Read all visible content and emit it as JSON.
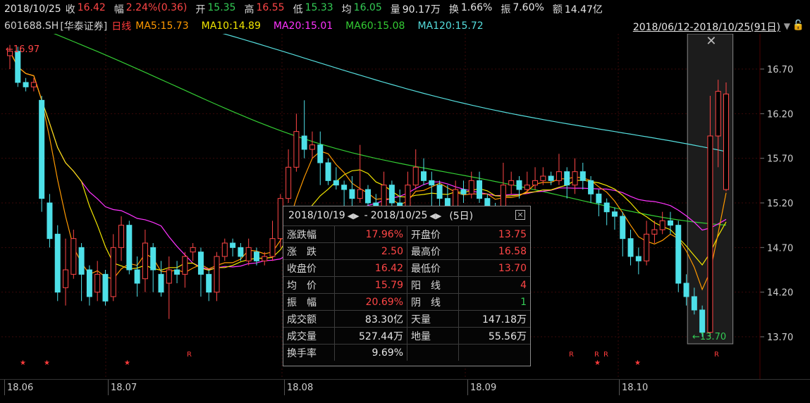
{
  "quote": {
    "date": "2018/10/25",
    "close_label": "收",
    "close": "16.42",
    "change_label": "幅",
    "change": "2.24%(0.36)",
    "open_label": "开",
    "open": "15.35",
    "high_label": "高",
    "high": "16.55",
    "low_label": "低",
    "low": "15.33",
    "avg_label": "均",
    "avg": "16.05",
    "volume_label": "量",
    "volume": "90.17万",
    "turnover_label": "换",
    "turnover": "1.66%",
    "amplitude_label": "振",
    "amplitude": "7.60%",
    "amount_label": "额",
    "amount": "14.47亿"
  },
  "legend": {
    "code": "601688.SH",
    "name": "[华泰证券]",
    "timeframe": "日线",
    "ma5": "MA5:15.73",
    "ma10": "MA10:14.89",
    "ma20": "MA20:15.01",
    "ma60": "MA60:15.08",
    "ma120": "MA120:15.72",
    "range": "2018/06/12-2018/10/25(91日)"
  },
  "colors": {
    "up": "#ff4646",
    "down": "#33cc55",
    "ma5": "#ff9900",
    "ma10": "#f2e600",
    "ma20": "#ff33ff",
    "ma60": "#33cc33",
    "ma120": "#55dddd",
    "candle_down": "#4ee0e8"
  },
  "axis": {
    "y_ticks": [
      "16.70",
      "16.20",
      "15.70",
      "15.20",
      "14.70",
      "14.20",
      "13.70"
    ],
    "x_labels": [
      "18.06",
      "18.07",
      "18.08",
      "18.09",
      "18.10"
    ],
    "max_marker": "16.97",
    "min_marker": "13.70"
  },
  "markers": [
    "★",
    "★",
    "★",
    "R",
    "R",
    "R",
    "R",
    "★",
    "★",
    "R"
  ],
  "popup": {
    "start": "2018/10/19",
    "end": "2018/10/25",
    "days": "(5日)",
    "rows": [
      {
        "k1": "涨跌幅",
        "v1": "17.96%",
        "k2": "开盘价",
        "v2": "13.75"
      },
      {
        "k1": "涨　跌",
        "v1": "2.50",
        "k2": "最高价",
        "v2": "16.58"
      },
      {
        "k1": "收盘价",
        "v1": "16.42",
        "k2": "最低价",
        "v2": "13.70"
      },
      {
        "k1": "均　价",
        "v1": "15.79",
        "k2": "阳　线",
        "v2": "4"
      },
      {
        "k1": "振　幅",
        "v1": "20.69%",
        "k2": "阴　线",
        "v2": "1"
      },
      {
        "k1": "成交额",
        "v1": "83.30亿",
        "k2": "天量",
        "v2": "147.18万"
      },
      {
        "k1": "成交量",
        "v1": "527.44万",
        "k2": "地量",
        "v2": "55.56万"
      },
      {
        "k1": "换手率",
        "v1": "9.69%",
        "k2": "",
        "v2": ""
      }
    ]
  },
  "chart_data": {
    "type": "candlestick",
    "ylim": [
      13.6,
      17.1
    ],
    "y_ticks": [
      16.7,
      16.2,
      15.7,
      15.2,
      14.7,
      14.2,
      13.7
    ],
    "candles": [
      [
        16.85,
        16.9,
        16.97,
        16.7
      ],
      [
        16.9,
        16.55,
        16.95,
        16.5
      ],
      [
        16.55,
        16.5,
        16.6,
        16.45
      ],
      [
        16.5,
        16.55,
        16.6,
        16.45
      ],
      [
        16.35,
        15.25,
        16.4,
        15.1
      ],
      [
        15.2,
        14.8,
        15.3,
        14.7
      ],
      [
        14.85,
        14.2,
        14.95,
        14.1
      ],
      [
        14.25,
        14.45,
        14.8,
        14.05
      ],
      [
        14.4,
        14.8,
        14.9,
        14.35
      ],
      [
        14.7,
        14.4,
        14.75,
        14.1
      ],
      [
        14.45,
        14.15,
        14.5,
        14.05
      ],
      [
        14.2,
        14.4,
        14.55,
        14.1
      ],
      [
        14.4,
        14.1,
        14.45,
        14.05
      ],
      [
        14.15,
        14.7,
        14.85,
        14.1
      ],
      [
        14.7,
        14.95,
        15.05,
        14.55
      ],
      [
        14.95,
        14.45,
        15.0,
        14.4
      ],
      [
        14.45,
        14.3,
        14.6,
        14.15
      ],
      [
        14.35,
        14.75,
        14.9,
        14.2
      ],
      [
        14.7,
        14.45,
        14.75,
        14.2
      ],
      [
        14.4,
        14.2,
        14.55,
        14.15
      ],
      [
        14.3,
        14.45,
        14.6,
        13.9
      ],
      [
        14.45,
        14.4,
        14.55,
        14.3
      ],
      [
        14.4,
        14.6,
        14.65,
        14.25
      ],
      [
        14.65,
        14.7,
        14.75,
        14.55
      ],
      [
        14.65,
        14.4,
        14.7,
        14.15
      ],
      [
        14.4,
        14.2,
        14.45,
        14.1
      ],
      [
        14.2,
        14.6,
        14.65,
        14.1
      ],
      [
        14.6,
        14.75,
        14.8,
        14.55
      ],
      [
        14.75,
        14.7,
        14.8,
        14.6
      ],
      [
        14.7,
        14.6,
        14.75,
        14.55
      ],
      [
        14.55,
        14.7,
        14.8,
        14.5
      ],
      [
        14.65,
        14.55,
        14.7,
        14.5
      ],
      [
        14.55,
        14.6,
        14.65,
        14.5
      ],
      [
        14.6,
        14.8,
        15.0,
        14.55
      ],
      [
        14.8,
        15.25,
        15.3,
        14.7
      ],
      [
        15.25,
        15.6,
        15.8,
        15.2
      ],
      [
        15.6,
        16.0,
        16.2,
        15.55
      ],
      [
        15.95,
        15.8,
        16.35,
        15.7
      ],
      [
        15.8,
        15.85,
        16.0,
        15.7
      ],
      [
        15.85,
        15.65,
        16.0,
        15.4
      ],
      [
        15.65,
        15.45,
        15.7,
        15.4
      ],
      [
        15.45,
        15.4,
        15.6,
        15.35
      ],
      [
        15.4,
        15.35,
        15.45,
        15.15
      ],
      [
        15.35,
        15.25,
        15.5,
        15.1
      ],
      [
        15.25,
        15.35,
        15.85,
        15.2
      ],
      [
        15.35,
        15.2,
        15.4,
        15.0
      ],
      [
        15.2,
        15.05,
        15.3,
        14.9
      ],
      [
        15.05,
        15.4,
        15.55,
        15.0
      ],
      [
        15.4,
        15.2,
        15.45,
        15.1
      ],
      [
        15.2,
        15.05,
        15.35,
        15.0
      ],
      [
        15.05,
        15.4,
        15.55,
        15.0
      ],
      [
        15.4,
        15.6,
        15.8,
        15.35
      ],
      [
        15.55,
        15.45,
        15.7,
        15.4
      ],
      [
        15.45,
        15.4,
        15.55,
        15.15
      ],
      [
        15.4,
        15.25,
        15.45,
        15.1
      ],
      [
        15.25,
        15.15,
        15.4,
        15.05
      ],
      [
        15.15,
        15.35,
        15.45,
        15.0
      ],
      [
        15.35,
        15.3,
        15.45,
        15.2
      ],
      [
        15.3,
        15.45,
        15.55,
        15.25
      ],
      [
        15.45,
        15.25,
        15.55,
        15.2
      ],
      [
        15.25,
        15.15,
        15.3,
        15.0
      ],
      [
        15.15,
        15.05,
        15.2,
        14.9
      ],
      [
        15.05,
        15.4,
        15.65,
        15.0
      ],
      [
        15.4,
        15.45,
        15.55,
        15.3
      ],
      [
        15.45,
        15.35,
        15.5,
        15.25
      ],
      [
        15.35,
        15.4,
        15.55,
        15.3
      ],
      [
        15.4,
        15.45,
        15.6,
        15.35
      ],
      [
        15.45,
        15.5,
        15.6,
        15.4
      ],
      [
        15.5,
        15.45,
        15.55,
        15.4
      ],
      [
        15.45,
        15.55,
        15.75,
        15.4
      ],
      [
        15.55,
        15.4,
        15.6,
        15.25
      ],
      [
        15.4,
        15.55,
        15.7,
        15.3
      ],
      [
        15.55,
        15.45,
        15.65,
        15.35
      ],
      [
        15.45,
        15.3,
        15.5,
        15.2
      ],
      [
        15.3,
        15.2,
        15.35,
        15.05
      ],
      [
        15.2,
        15.1,
        15.25,
        14.95
      ],
      [
        15.1,
        15.05,
        15.15,
        14.9
      ],
      [
        15.05,
        14.8,
        15.1,
        14.6
      ],
      [
        14.8,
        14.6,
        14.9,
        14.5
      ],
      [
        14.6,
        14.55,
        14.7,
        14.4
      ],
      [
        14.55,
        14.85,
        15.0,
        14.5
      ],
      [
        14.85,
        14.9,
        15.0,
        14.75
      ],
      [
        14.9,
        15.0,
        15.1,
        14.85
      ],
      [
        15.0,
        14.95,
        15.1,
        14.85
      ],
      [
        14.95,
        14.3,
        15.0,
        14.2
      ],
      [
        14.3,
        14.15,
        14.4,
        14.05
      ],
      [
        14.15,
        14.0,
        14.25,
        13.95
      ],
      [
        14.0,
        13.75,
        14.05,
        13.7
      ],
      [
        13.75,
        15.95,
        16.4,
        13.7
      ],
      [
        15.95,
        16.45,
        16.58,
        15.6
      ],
      [
        15.35,
        16.42,
        16.55,
        15.33
      ]
    ]
  }
}
